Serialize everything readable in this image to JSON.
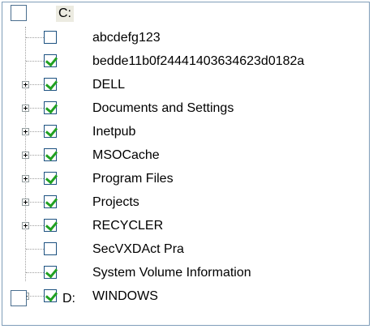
{
  "tree": {
    "root_c": {
      "label": "C:",
      "checked": false
    },
    "items": [
      {
        "label": "abcdefg123",
        "checked": false,
        "expandable": false
      },
      {
        "label": "bedde11b0f24441403634623d0182a",
        "checked": true,
        "expandable": false
      },
      {
        "label": "DELL",
        "checked": true,
        "expandable": true
      },
      {
        "label": "Documents and Settings",
        "checked": true,
        "expandable": true
      },
      {
        "label": "Inetpub",
        "checked": true,
        "expandable": true
      },
      {
        "label": "MSOCache",
        "checked": true,
        "expandable": true
      },
      {
        "label": "Program Files",
        "checked": true,
        "expandable": true
      },
      {
        "label": "Projects",
        "checked": true,
        "expandable": true
      },
      {
        "label": "RECYCLER",
        "checked": true,
        "expandable": true
      },
      {
        "label": "SecVXDAct Pra",
        "checked": false,
        "expandable": false
      },
      {
        "label": "System Volume Information",
        "checked": true,
        "expandable": false
      },
      {
        "label": "WINDOWS",
        "checked": true,
        "expandable": true
      }
    ],
    "root_d": {
      "label": "D:",
      "checked": false
    }
  },
  "colors": {
    "check": "#21a121",
    "checkbox_border": "#1c5180",
    "tree_border": "#7f9db9"
  }
}
